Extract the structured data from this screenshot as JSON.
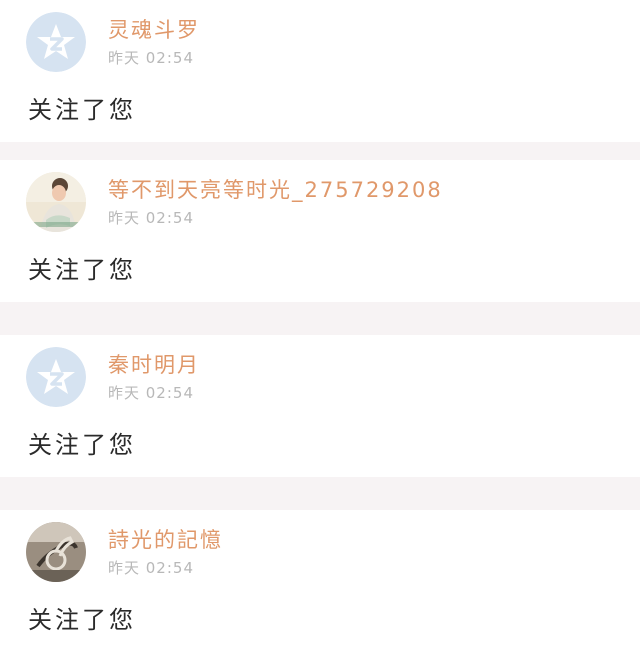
{
  "notifications": [
    {
      "avatar_icon": "qzone-default-avatar-icon",
      "username": "灵魂斗罗",
      "time": "昨天 02:54",
      "message": "关注了您"
    },
    {
      "avatar_icon": "photo-avatar-girl-icon",
      "username": "等不到天亮等时光_275729208",
      "time": "昨天 02:54",
      "message": "关注了您"
    },
    {
      "avatar_icon": "qzone-default-avatar-icon",
      "username": "秦时明月",
      "time": "昨天 02:54",
      "message": "关注了您"
    },
    {
      "avatar_icon": "photo-avatar-music-note-icon",
      "username": "詩光的記憶",
      "time": "昨天 02:54",
      "message": "关注了您"
    }
  ],
  "colors": {
    "username": "#e0986a",
    "timestamp": "#b8b8b8",
    "separator": "#f7f3f4",
    "default_avatar": "#d6e3f1"
  }
}
